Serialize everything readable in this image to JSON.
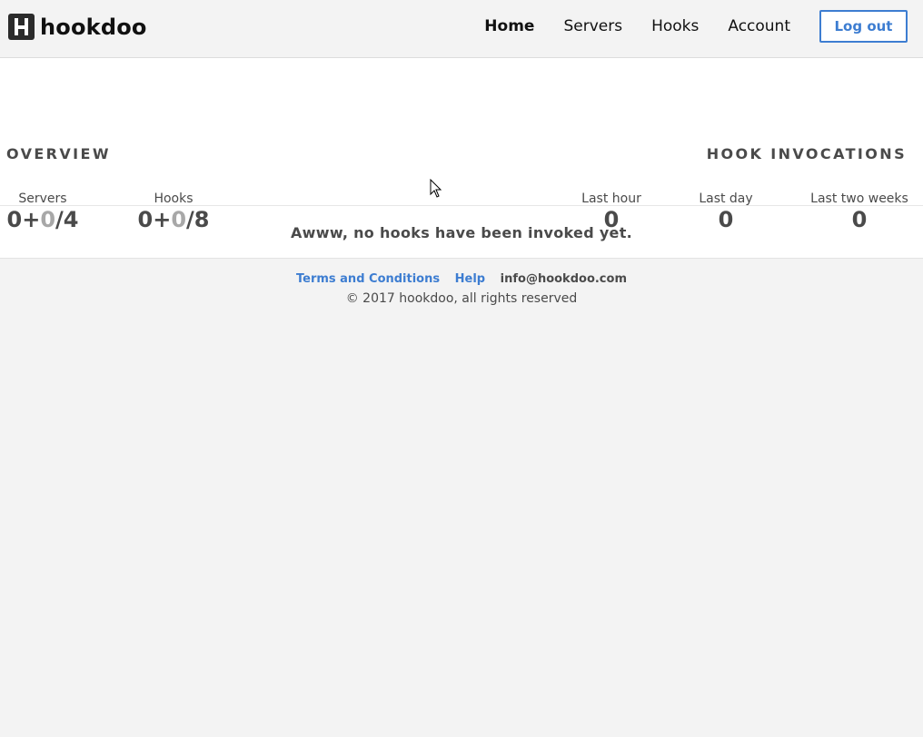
{
  "header": {
    "logo_text": "hookdoo",
    "nav": [
      {
        "label": "Home",
        "active": true
      },
      {
        "label": "Servers"
      },
      {
        "label": "Hooks"
      },
      {
        "label": "Account"
      }
    ],
    "logout_label": "Log out"
  },
  "overview": {
    "title": "OVERVIEW",
    "servers": {
      "label": "Servers",
      "a": "0",
      "plus": "+",
      "b": "0",
      "slash": "/",
      "total": "4"
    },
    "hooks": {
      "label": "Hooks",
      "a": "0",
      "plus": "+",
      "b": "0",
      "slash": "/",
      "total": "8"
    }
  },
  "invocations": {
    "title": "HOOK INVOCATIONS",
    "last_hour": {
      "label": "Last hour",
      "value": "0"
    },
    "last_day": {
      "label": "Last day",
      "value": "0"
    },
    "last_two_weeks": {
      "label": "Last two weeks",
      "value": "0"
    }
  },
  "empty_message": "Awww, no hooks have been invoked yet.",
  "footer": {
    "terms": "Terms and Conditions",
    "help": "Help",
    "email": "info@hookdoo.com",
    "copyright": "© 2017 hookdoo, all rights reserved"
  },
  "colors": {
    "accent": "#3d7dd1",
    "text": "#4a4a4a",
    "muted": "#a8a8a8"
  }
}
